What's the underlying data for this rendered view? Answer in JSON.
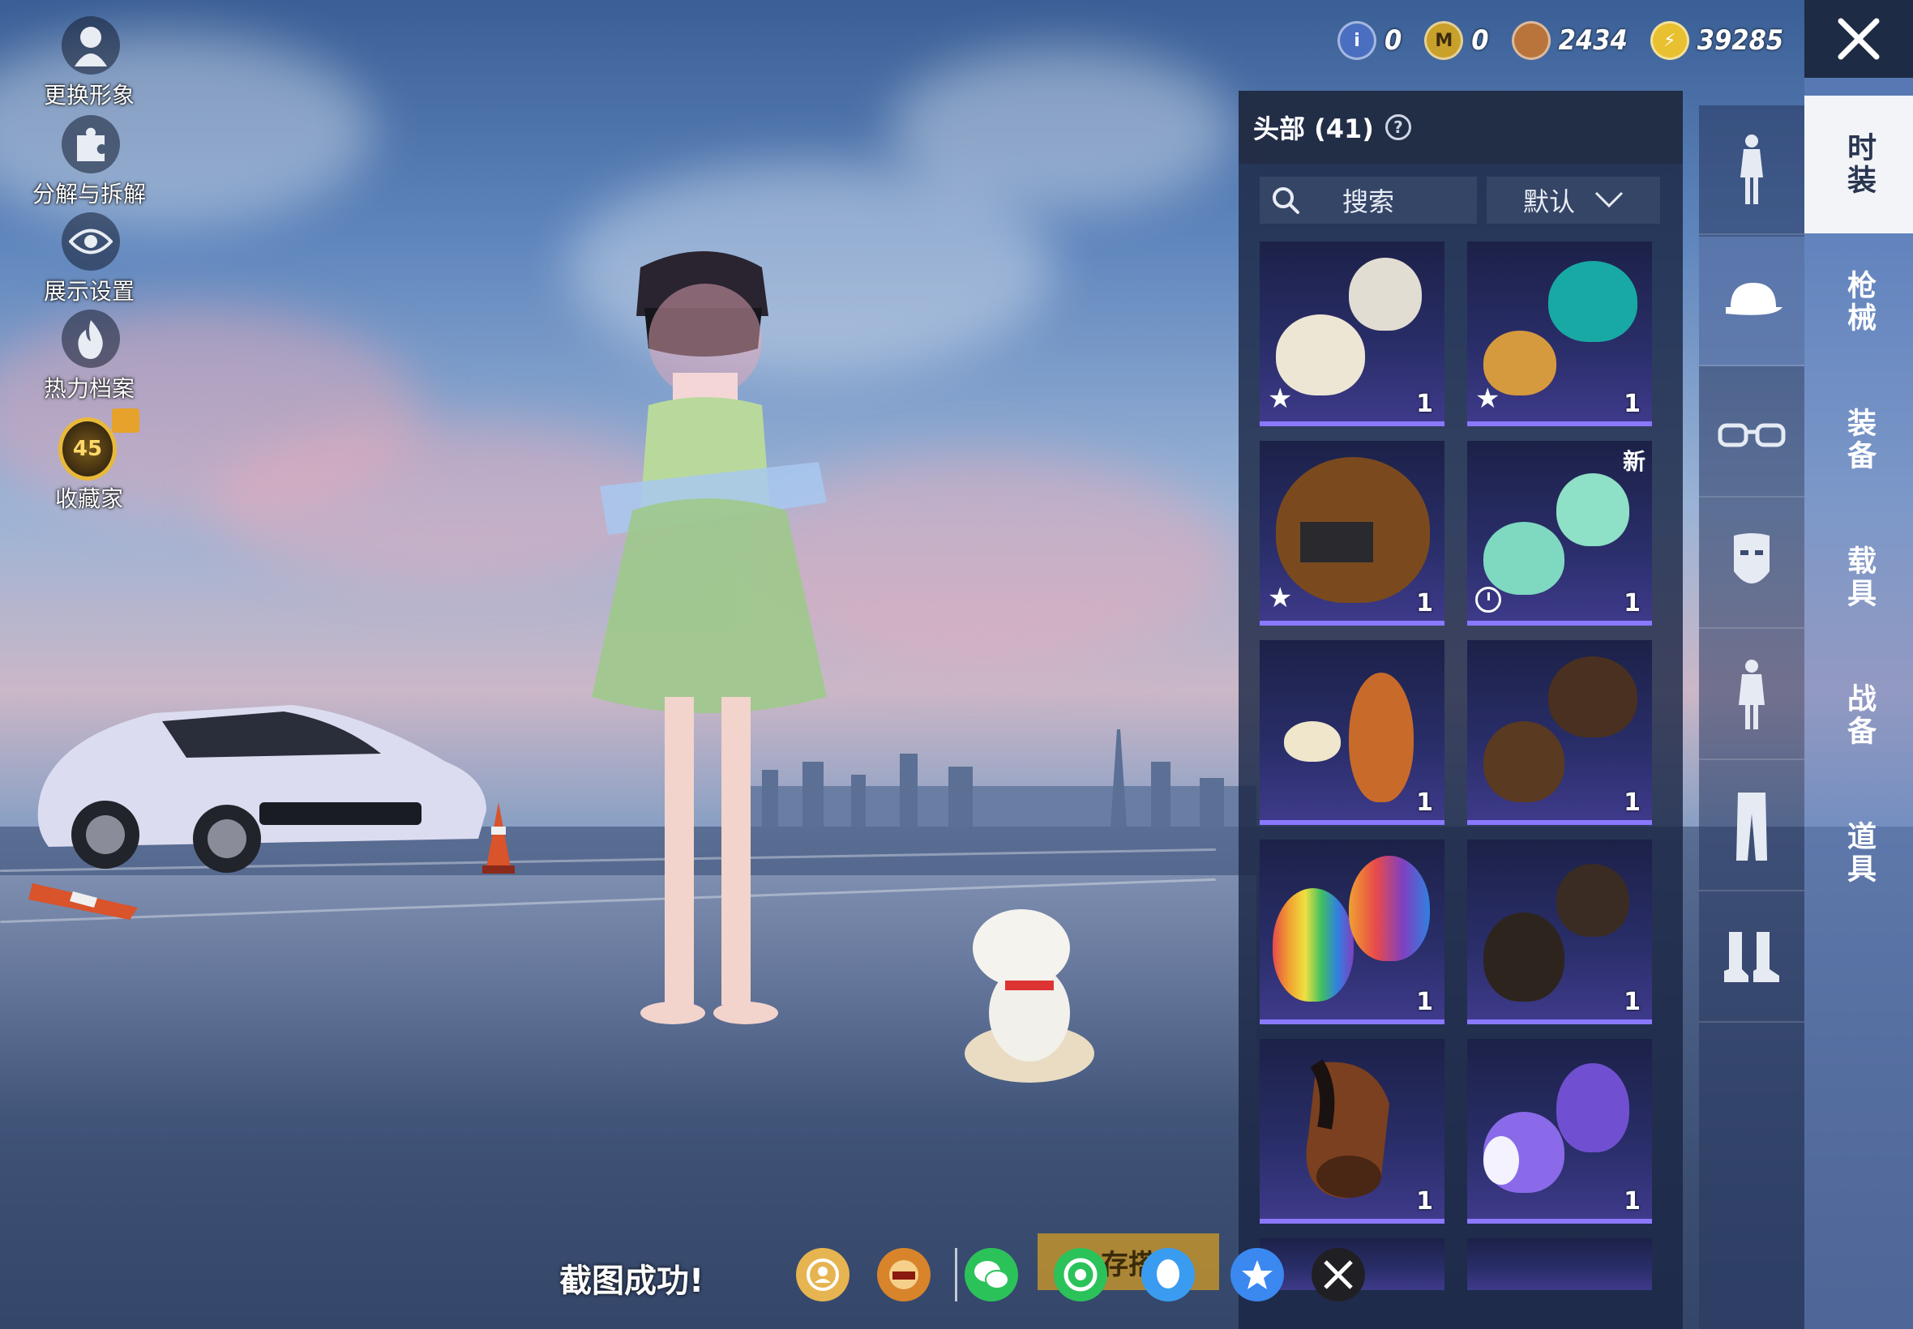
{
  "left_menu": [
    {
      "label": "更换形象",
      "icon": "avatar-icon"
    },
    {
      "label": "分解与拆解",
      "icon": "puzzle-icon"
    },
    {
      "label": "展示设置",
      "icon": "eye-icon"
    },
    {
      "label": "热力档案",
      "icon": "flame-icon"
    },
    {
      "label": "收藏家",
      "icon": "collector-badge-icon",
      "level": "45"
    }
  ],
  "currencies": [
    {
      "icon": "token-blue-icon",
      "value": "0",
      "color": "#4a6fc0"
    },
    {
      "icon": "token-gold-icon",
      "value": "0",
      "color": "#c8a02a"
    },
    {
      "icon": "coin-bronze-icon",
      "value": "2434",
      "color": "#b8743a"
    },
    {
      "icon": "coin-lightning-icon",
      "value": "39285",
      "color": "#e8c030"
    }
  ],
  "inventory": {
    "title": "头部 (41)",
    "search_placeholder": "搜索",
    "sort_label": "默认",
    "items": [
      {
        "name": "white-hair-item",
        "count": "1",
        "badge": "star"
      },
      {
        "name": "teal-hair-item",
        "count": "1",
        "badge": "star"
      },
      {
        "name": "brown-hair-headband-item",
        "count": "1",
        "badge": "star"
      },
      {
        "name": "mint-hair-item",
        "count": "1",
        "badge": "clock",
        "tag": "新"
      },
      {
        "name": "beret-ginger-hair-item",
        "count": "1"
      },
      {
        "name": "brown-pigtails-item",
        "count": "1"
      },
      {
        "name": "rainbow-hair-item",
        "count": "1"
      },
      {
        "name": "goggles-dark-hair-item",
        "count": "1"
      },
      {
        "name": "horse-mask-item",
        "count": "1"
      },
      {
        "name": "purple-earmuff-hair-item",
        "count": "1"
      }
    ]
  },
  "categories": [
    {
      "icon": "full-outfit-icon"
    },
    {
      "icon": "cap-icon",
      "active": true
    },
    {
      "icon": "glasses-icon"
    },
    {
      "icon": "mask-icon"
    },
    {
      "icon": "body-outfit-icon"
    },
    {
      "icon": "pants-icon"
    },
    {
      "icon": "boots-icon"
    }
  ],
  "tabs": [
    "时装",
    "枪械",
    "装备",
    "载具",
    "战备",
    "道具"
  ],
  "bottom": {
    "toast": "截图成功!",
    "save_label": "存搭"
  }
}
